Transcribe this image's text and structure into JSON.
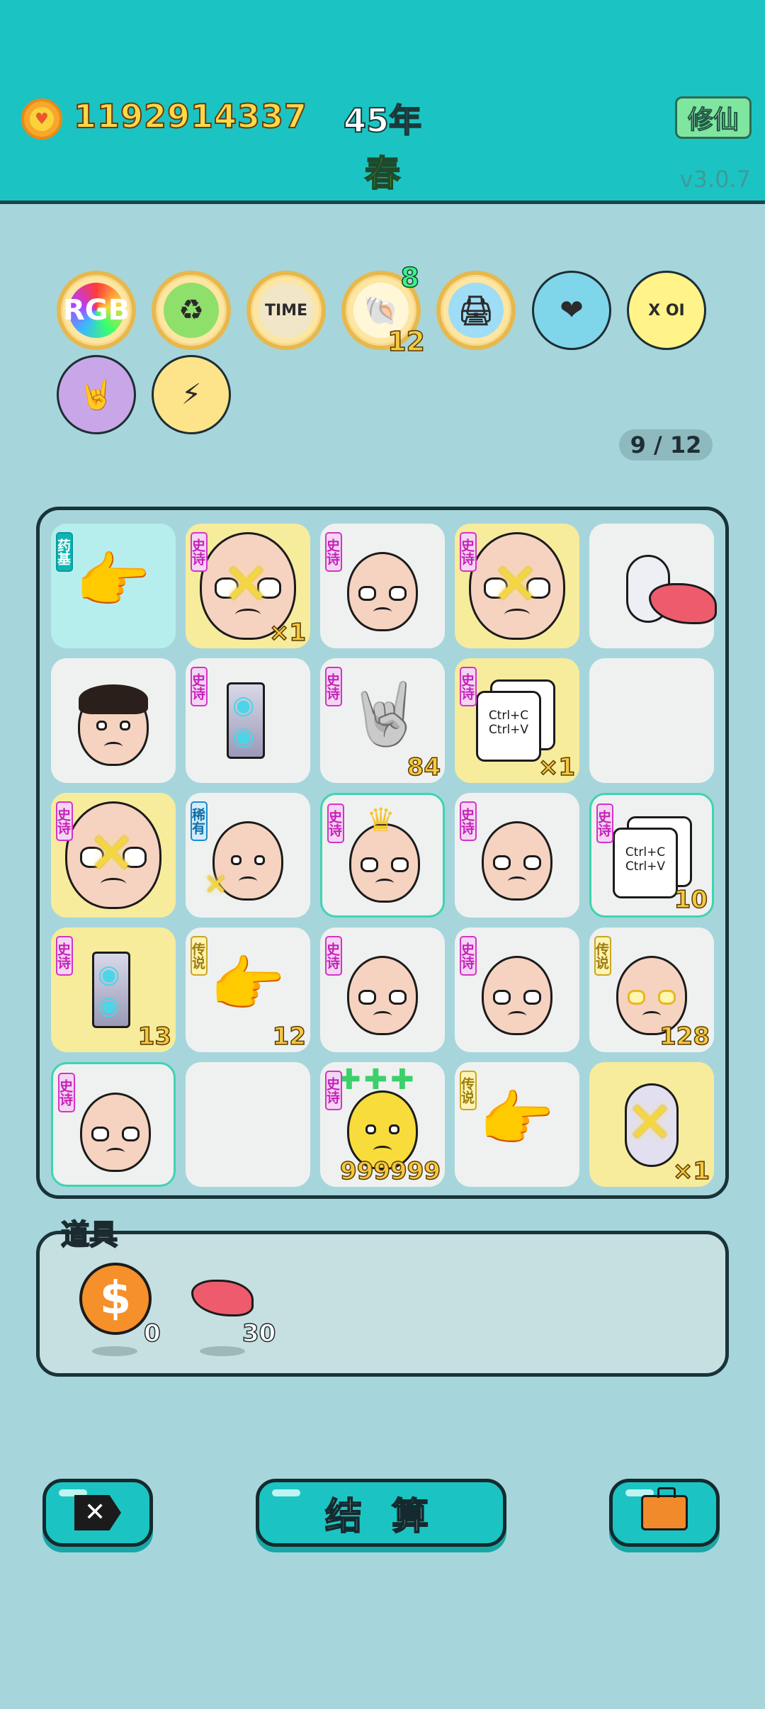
{
  "header": {
    "money": "1192914337",
    "year": "45年",
    "season": "春",
    "xiuxian_label": "修仙",
    "version": "v3.0.7",
    "coin_icon": "heart-coin-icon"
  },
  "relics": [
    {
      "name": "rgb-relic",
      "label": "RGB",
      "style": "gold"
    },
    {
      "name": "recycle-relic",
      "label": "♻",
      "style": "gold"
    },
    {
      "name": "time-magazine-relic",
      "label": "TIME",
      "style": "gold"
    },
    {
      "name": "shell-relic",
      "label": "🐚",
      "style": "gold",
      "top_number": "8",
      "bottom_number": "12"
    },
    {
      "name": "printer-relic",
      "label": "🖨",
      "style": "gold"
    },
    {
      "name": "blood-bag-relic",
      "label": "❤",
      "style": "plain"
    },
    {
      "name": "chip-relic",
      "label": "X OI",
      "style": "plain"
    },
    {
      "name": "rock-hand-relic",
      "label": "🤘",
      "style": "plain"
    },
    {
      "name": "lightning-relic",
      "label": "⚡",
      "style": "plain"
    }
  ],
  "pager": "9 / 12",
  "grid": {
    "rows": [
      [
        {
          "bg": "cyan",
          "tag": "药基",
          "tag_type": "herb",
          "item": "pointing-hand",
          "count": ""
        },
        {
          "bg": "yellow",
          "tag": "史诗",
          "tag_type": "epic",
          "item": "bald-glasses-face-big",
          "count": "×1"
        },
        {
          "bg": "plain",
          "tag": "史诗",
          "tag_type": "epic",
          "item": "bald-glasses-face",
          "count": ""
        },
        {
          "bg": "yellow",
          "tag": "史诗",
          "tag_type": "epic",
          "item": "bald-glasses-face-big",
          "count": ""
        },
        {
          "bg": "plain",
          "tag": "",
          "tag_type": "",
          "item": "mouse-liver",
          "count": ""
        }
      ],
      [
        {
          "bg": "plain",
          "tag": "",
          "tag_type": "",
          "item": "hair-face",
          "count": ""
        },
        {
          "bg": "plain",
          "tag": "史诗",
          "tag_type": "epic",
          "item": "graphics-card",
          "count": ""
        },
        {
          "bg": "plain",
          "tag": "史诗",
          "tag_type": "epic",
          "item": "grey-hand",
          "count": "84"
        },
        {
          "bg": "yellow",
          "tag": "史诗",
          "tag_type": "epic",
          "item": "ctrl-cv-card",
          "count": "×1"
        },
        {
          "bg": "plain",
          "tag": "",
          "tag_type": "",
          "item": "empty",
          "count": ""
        }
      ],
      [
        {
          "bg": "yellow",
          "tag": "史诗",
          "tag_type": "epic",
          "item": "bald-glasses-face-big",
          "count": ""
        },
        {
          "bg": "plain",
          "tag": "稀有",
          "tag_type": "rare",
          "item": "bald-face",
          "count": ""
        },
        {
          "bg": "plain",
          "glow": true,
          "tag": "史诗",
          "tag_type": "epic",
          "item": "crown-face",
          "count": ""
        },
        {
          "bg": "plain",
          "tag": "史诗",
          "tag_type": "epic",
          "item": "bald-glasses-face",
          "count": ""
        },
        {
          "bg": "plain",
          "glow": true,
          "tag": "史诗",
          "tag_type": "epic",
          "item": "ctrl-cv-card",
          "count": "10"
        }
      ],
      [
        {
          "bg": "yellow",
          "tag": "史诗",
          "tag_type": "epic",
          "item": "graphics-card",
          "count": "13"
        },
        {
          "bg": "plain",
          "tag": "传说",
          "tag_type": "legend",
          "item": "pointing-hand",
          "count": "12"
        },
        {
          "bg": "plain",
          "tag": "史诗",
          "tag_type": "epic",
          "item": "bald-glasses-face",
          "count": ""
        },
        {
          "bg": "plain",
          "tag": "史诗",
          "tag_type": "epic",
          "item": "bald-glasses-face",
          "count": ""
        },
        {
          "bg": "plain",
          "tag": "传说",
          "tag_type": "legend",
          "item": "gold-glasses-face",
          "count": "128"
        }
      ],
      [
        {
          "bg": "plain",
          "glow": true,
          "tag": "史诗",
          "tag_type": "epic",
          "item": "bald-glasses-face",
          "count": ""
        },
        {
          "bg": "plain",
          "tag": "",
          "tag_type": "",
          "item": "empty",
          "count": ""
        },
        {
          "bg": "plain",
          "tag": "史诗",
          "tag_type": "epic",
          "item": "yellow-sprout-face",
          "count": "999999"
        },
        {
          "bg": "plain",
          "tag": "传说",
          "tag_type": "legend",
          "item": "pointing-hand",
          "count": ""
        },
        {
          "bg": "yellow",
          "tag": "",
          "tag_type": "",
          "item": "mouse",
          "count": "×1"
        }
      ]
    ]
  },
  "props": {
    "title": "道具",
    "items": [
      {
        "name": "dollar-coin-prop",
        "count": "0"
      },
      {
        "name": "liver-prop",
        "count": "30"
      }
    ]
  },
  "buttons": {
    "close_icon": "close-tag-icon",
    "settle": "结 算",
    "bag_icon": "briefcase-icon"
  },
  "colors": {
    "header_bg": "#1bc4c2",
    "body_bg": "#a6d6dc",
    "money": "#ffd84a",
    "season": "#6fe05a"
  }
}
